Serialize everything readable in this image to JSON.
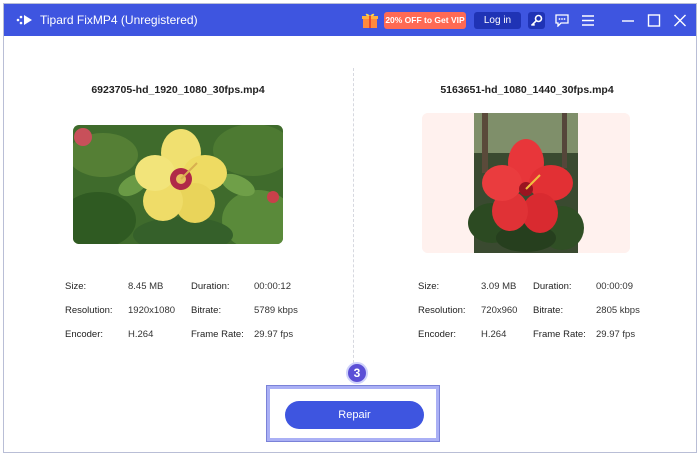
{
  "window": {
    "title": "Tipard FixMP4 (Unregistered)",
    "promo_label": "20% OFF to Get VIP",
    "login_label": "Log in",
    "icons": [
      "app-logo-icon",
      "gift-icon",
      "key-icon",
      "feedback-icon",
      "menu-icon",
      "minimize-icon",
      "maximize-icon",
      "close-icon"
    ]
  },
  "left_video": {
    "file_name": "6923705-hd_1920_1080_30fps.mp4",
    "size_label": "Size:",
    "size": "8.45 MB",
    "duration_label": "Duration:",
    "duration": "00:00:12",
    "resolution_label": "Resolution:",
    "resolution": "1920x1080",
    "bitrate_label": "Bitrate:",
    "bitrate": "5789 kbps",
    "encoder_label": "Encoder:",
    "encoder": "H.264",
    "frame_rate_label": "Frame Rate:",
    "frame_rate": "29.97 fps"
  },
  "right_video": {
    "file_name": "5163651-hd_1080_1440_30fps.mp4",
    "size_label": "Size:",
    "size": "3.09 MB",
    "duration_label": "Duration:",
    "duration": "00:00:09",
    "resolution_label": "Resolution:",
    "resolution": "720x960",
    "bitrate_label": "Bitrate:",
    "bitrate": "2805 kbps",
    "encoder_label": "Encoder:",
    "encoder": "H.264",
    "frame_rate_label": "Frame Rate:",
    "frame_rate": "29.97 fps"
  },
  "actions": {
    "repair_label": "Repair",
    "step_number": "3"
  },
  "colors": {
    "titlebar": "#3e55e0",
    "promo": "#ff6a54",
    "login": "#1f33b5",
    "repair": "#3e55e0",
    "step_badge": "#5b4fd6"
  }
}
